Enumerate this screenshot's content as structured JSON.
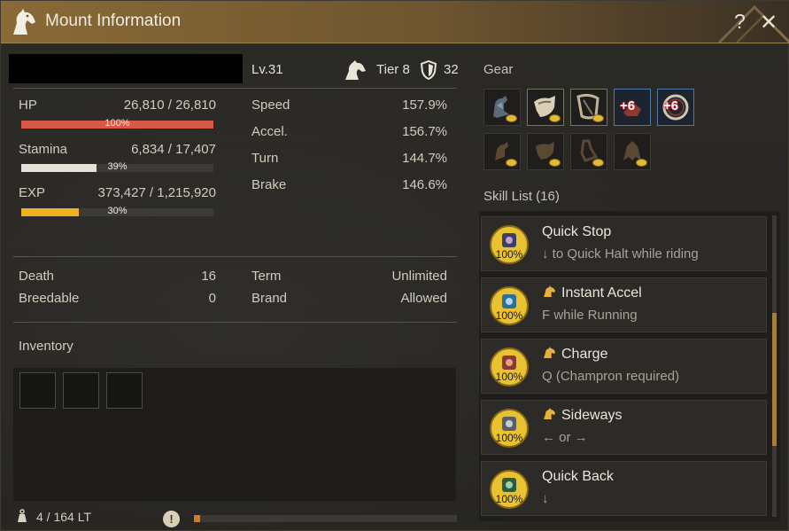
{
  "window": {
    "title": "Mount Information",
    "help_label": "?",
    "close_label": "✕"
  },
  "header": {
    "level": "Lv.31",
    "tier": "Tier 8",
    "tier_value": "32"
  },
  "stats": {
    "hp": {
      "label": "HP",
      "value": "26,810 / 26,810",
      "percent": 100,
      "percent_label": "100%",
      "color": "#d65a45"
    },
    "stamina": {
      "label": "Stamina",
      "value": "6,834 / 17,407",
      "percent": 39,
      "percent_label": "39%",
      "color": "#e5e1d4"
    },
    "exp": {
      "label": "EXP",
      "value": "373,427 / 1,215,920",
      "percent": 30,
      "percent_label": "30%",
      "color": "#f2b21f"
    }
  },
  "attributes": [
    {
      "label": "Speed",
      "value": "157.9%"
    },
    {
      "label": "Accel.",
      "value": "156.7%"
    },
    {
      "label": "Turn",
      "value": "144.7%"
    },
    {
      "label": "Brake",
      "value": "146.6%"
    }
  ],
  "status": {
    "death_label": "Death",
    "death_value": "16",
    "breedable_label": "Breedable",
    "breedable_value": "0",
    "term_label": "Term",
    "term_value": "Unlimited",
    "brand_label": "Brand",
    "brand_value": "Allowed"
  },
  "inventory": {
    "title": "Inventory",
    "weight": "4 / 164 LT",
    "weight_percent": 2.4,
    "warning_label": "!"
  },
  "gear": {
    "title": "Gear",
    "row1": [
      {
        "icon": "horse-armor-icon",
        "enhance": ""
      },
      {
        "icon": "saddle-icon",
        "enhance": ""
      },
      {
        "icon": "stirrups-icon",
        "enhance": ""
      },
      {
        "icon": "horseshoe-icon",
        "enhance": "+6"
      },
      {
        "icon": "horseshoe-ring-icon",
        "enhance": "+6"
      }
    ],
    "row2": [
      {
        "icon": "barding-slot-icon"
      },
      {
        "icon": "saddle-slot-icon"
      },
      {
        "icon": "stirrup-slot-icon"
      },
      {
        "icon": "champron-slot-icon"
      }
    ]
  },
  "skills": {
    "title": "Skill List (16)",
    "items": [
      {
        "name": "Quick Stop",
        "desc": "↓ to Quick Halt while riding",
        "badge": "100%",
        "has_horse": false
      },
      {
        "name": "Instant Accel",
        "desc": "F while Running",
        "badge": "100%",
        "has_horse": true
      },
      {
        "name": "Charge",
        "desc": "Q (Champron required)",
        "badge": "100%",
        "has_horse": true
      },
      {
        "name": "Sideways",
        "desc": "← or →",
        "badge": "100%",
        "has_horse": true
      },
      {
        "name": "Quick Back",
        "desc": "↓",
        "badge": "100%",
        "has_horse": false
      }
    ]
  }
}
